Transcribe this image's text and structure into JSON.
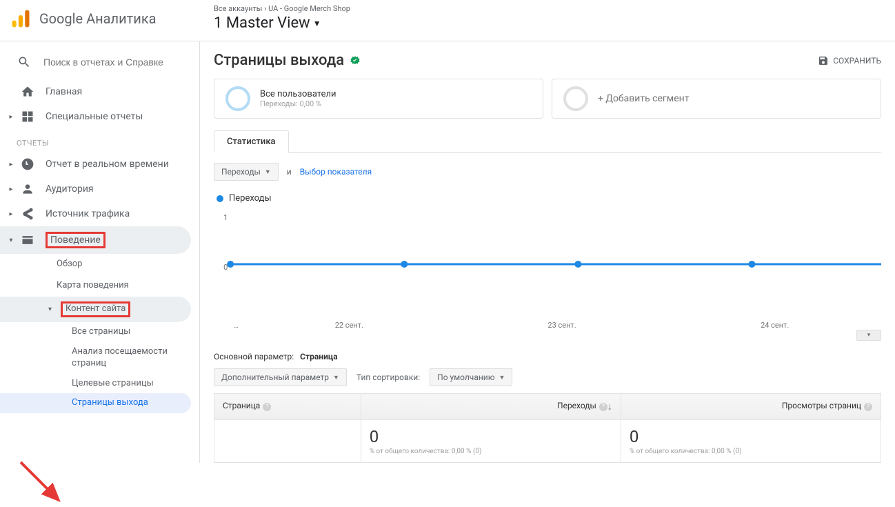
{
  "header": {
    "product_name": "Google Аналитика",
    "breadcrumb_all": "Все аккаунты",
    "breadcrumb_sep": " › ",
    "breadcrumb_prop": "UA - Google Merch Shop",
    "view_name": "1 Master View"
  },
  "sidebar": {
    "search_placeholder": "Поиск в отчетах и Справке",
    "home": "Главная",
    "custom": "Специальные отчеты",
    "section_reports": "ОТЧЕТЫ",
    "realtime": "Отчет в реальном времени",
    "audience": "Аудитория",
    "acquisition": "Источник трафика",
    "behavior": "Поведение",
    "behavior_sub": {
      "overview": "Обзор",
      "flow": "Карта поведения",
      "content": "Контент сайта",
      "all_pages": "Все страницы",
      "drilldown": "Анализ посещаемости страниц",
      "landing": "Целевые страницы",
      "exit": "Страницы выхода"
    }
  },
  "main": {
    "title": "Страницы выхода",
    "save": "СОХРАНИТЬ",
    "segment1_title": "Все пользователи",
    "segment1_sub": "Переходы: 0,00 %",
    "segment_add": "+ Добавить сегмент",
    "tab_stats": "Статистика",
    "metric_dropdown": "Переходы",
    "and": "и",
    "choose_metric": "Выбор показателя",
    "legend": "Переходы",
    "y_axis": {
      "top": "1",
      "bottom": "0"
    },
    "x_axis": [
      "…",
      "22 сент.",
      "23 сент.",
      "24 сент."
    ],
    "primary_dim_label": "Основной параметр:",
    "primary_dim_value": "Страница",
    "secondary_dim": "Дополнительный параметр",
    "sort_type_label": "Тип сортировки:",
    "sort_type_value": "По умолчанию",
    "table": {
      "col_page": "Страница",
      "col_exits": "Переходы",
      "col_views": "Просмотры страниц",
      "exits_value": "0",
      "exits_sub": "% от общего количества: 0,00 % (0)",
      "views_value": "0",
      "views_sub": "% от общего количества: 0,00 % (0)"
    }
  },
  "chart_data": {
    "type": "line",
    "x": [
      "…",
      "22 сент.",
      "23 сент.",
      "24 сент."
    ],
    "series": [
      {
        "name": "Переходы",
        "values": [
          0,
          0,
          0,
          0
        ]
      }
    ],
    "ylabel": "",
    "ylim": [
      0,
      1
    ]
  },
  "colors": {
    "accent": "#1e88e5",
    "highlight": "#e53935",
    "link": "#1a73e8"
  }
}
